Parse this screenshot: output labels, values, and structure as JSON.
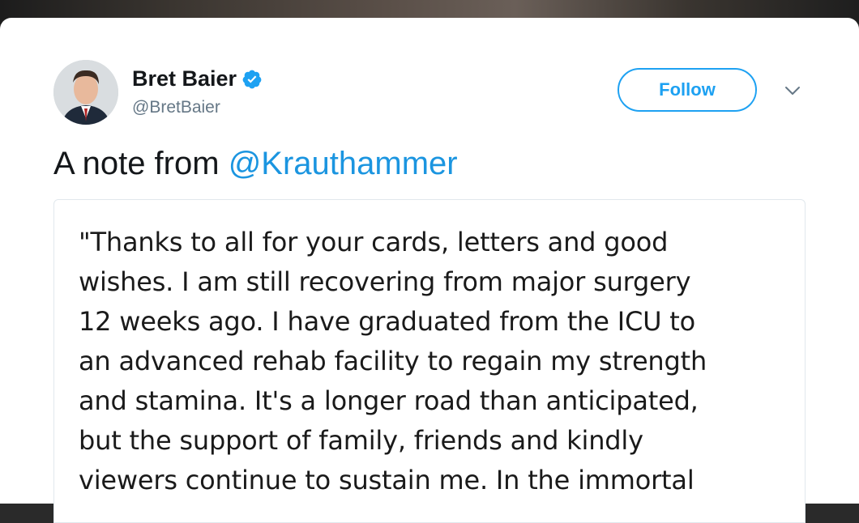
{
  "tweet": {
    "author": {
      "name": "Bret Baier",
      "handle": "@BretBaier",
      "verified": true,
      "avatar_icon": "profile-photo"
    },
    "follow_label": "Follow",
    "menu_icon": "chevron-down-icon",
    "text_prefix": "A note from",
    "mention": "@Krauthammer",
    "image_text_lines": [
      "\"Thanks to all for your cards, letters and good",
      "wishes. I am still recovering from major surgery",
      "12 weeks ago. I have graduated from the ICU to",
      "an advanced rehab facility to regain my strength",
      "and stamina. It's a longer road than anticipated,",
      "but the support of family, friends and kindly",
      "viewers continue to sustain me. In the immortal"
    ]
  },
  "colors": {
    "accent": "#1da1f2",
    "mention": "#1b95e0",
    "text": "#14171a",
    "secondary": "#657786"
  }
}
